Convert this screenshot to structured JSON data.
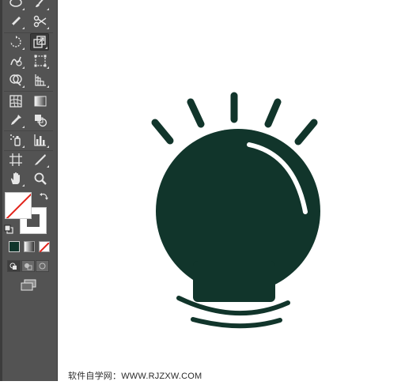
{
  "toolbar": {
    "tools": [
      {
        "name": "ellipse-tool",
        "icon": "ellipse-icon"
      },
      {
        "name": "brush-tool",
        "icon": "brush-icon"
      },
      {
        "name": "pencil-tool",
        "icon": "pencil-icon"
      },
      {
        "name": "scissors-tool",
        "icon": "scissors-icon"
      },
      {
        "name": "rotate-tool",
        "icon": "rotate-icon"
      },
      {
        "name": "scale-tool",
        "icon": "scale-icon",
        "active": true
      },
      {
        "name": "warp-tool",
        "icon": "warp-icon"
      },
      {
        "name": "free-transform-tool",
        "icon": "free-transform-icon"
      },
      {
        "name": "shape-builder-tool",
        "icon": "shape-builder-icon"
      },
      {
        "name": "perspective-grid-tool",
        "icon": "perspective-grid-icon"
      },
      {
        "name": "mesh-tool",
        "icon": "mesh-icon"
      },
      {
        "name": "gradient-tool",
        "icon": "gradient-icon"
      },
      {
        "name": "eyedropper-tool",
        "icon": "eyedropper-icon"
      },
      {
        "name": "blend-tool",
        "icon": "blend-icon"
      },
      {
        "name": "symbol-sprayer-tool",
        "icon": "symbol-sprayer-icon"
      },
      {
        "name": "column-graph-tool",
        "icon": "column-graph-icon"
      },
      {
        "name": "artboard-tool",
        "icon": "artboard-icon"
      },
      {
        "name": "slice-tool",
        "icon": "slice-icon"
      },
      {
        "name": "hand-tool",
        "icon": "hand-icon"
      },
      {
        "name": "zoom-tool",
        "icon": "zoom-icon"
      }
    ],
    "colors": {
      "fill": "none",
      "stroke": "#535353"
    },
    "color_modes": [
      "color-mode-button",
      "gradient-mode-button",
      "none-mode-button"
    ],
    "draw_modes": [
      "draw-normal-button",
      "draw-behind-button",
      "draw-inside-button"
    ],
    "screen_mode": "change-screen-mode-button"
  },
  "artwork": {
    "name": "light-bulb-icon",
    "color": "#11352b",
    "highlight_color": "#ffffff"
  },
  "watermark": "软件自学网：WWW.RJZXW.COM"
}
